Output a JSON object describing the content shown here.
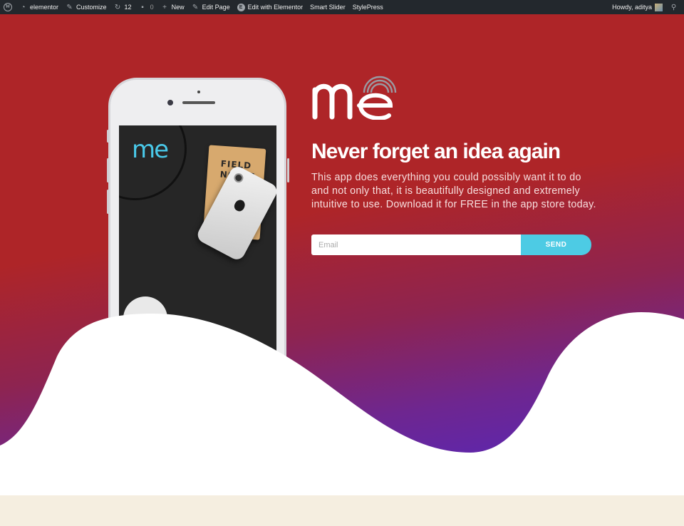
{
  "adminbar": {
    "site_name": "elementor",
    "customize": "Customize",
    "updates_count": "12",
    "comments_count": "0",
    "new": "New",
    "edit_page": "Edit Page",
    "edit_with_elementor": "Edit with Elementor",
    "smart_slider": "Smart Slider",
    "stylepress": "StylePress",
    "howdy": "Howdy, aditya"
  },
  "hero": {
    "title": "Never forget an idea again",
    "description": "This app does everything you could possibly want it to do and not only that, it is beautifully designed and extremely intuitive to use. Download it for FREE in the app store today.",
    "email_placeholder": "Email",
    "send_label": "SEND",
    "logo_text": "me",
    "phone_note_text": "FIELD NOTES"
  },
  "colors": {
    "hero_top": "#ae2528",
    "hero_bottom": "#4e27c8",
    "send_button": "#4dcbe4",
    "adminbar": "#23282d",
    "footer_band": "#f5eee0"
  }
}
